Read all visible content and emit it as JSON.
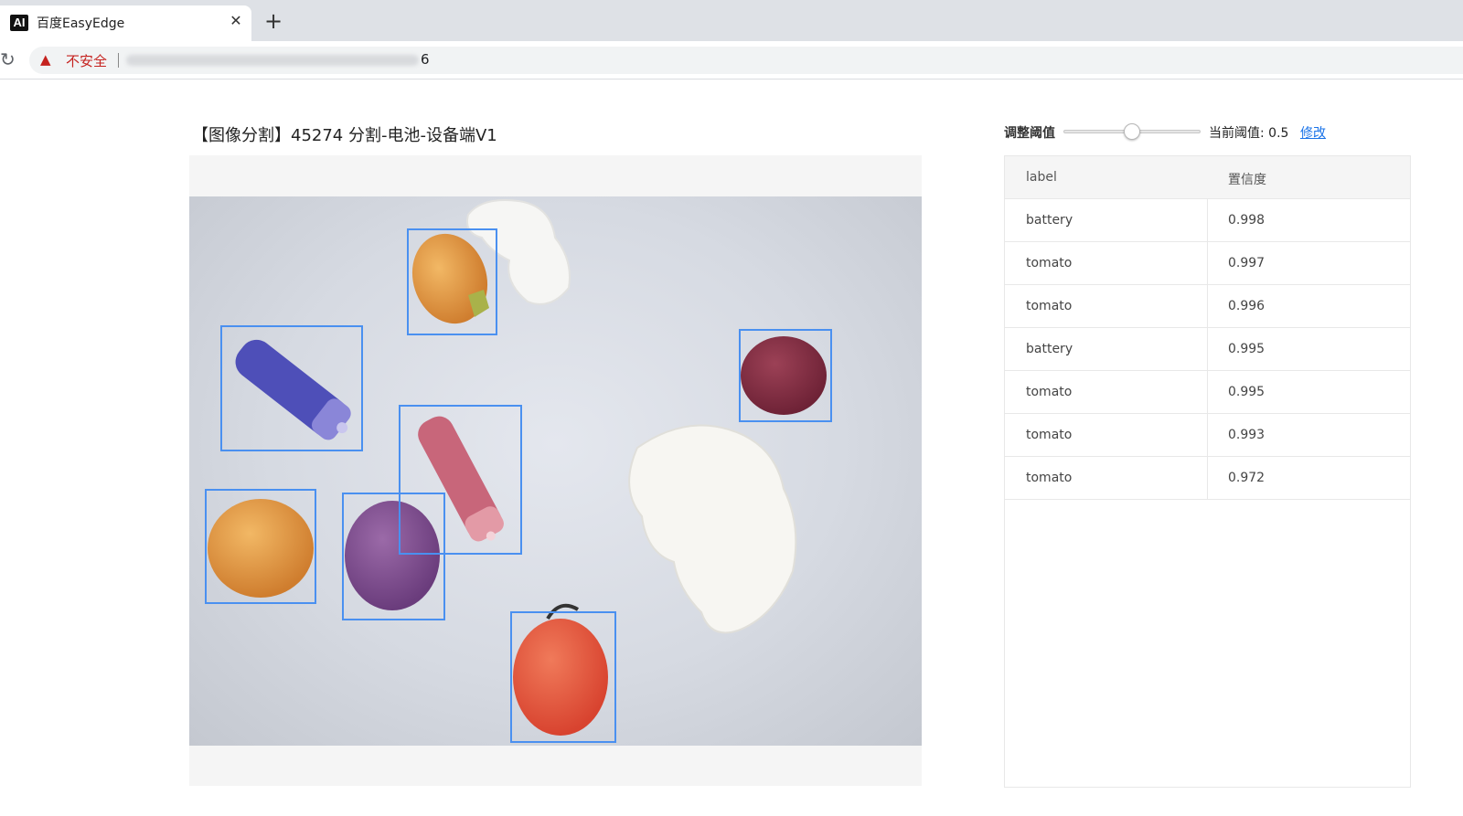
{
  "browser": {
    "tab_title": "百度EasyEdge",
    "favicon_text": "AI",
    "close_glyph": "✕",
    "new_tab_glyph": "+",
    "reload_glyph": "↻",
    "warning_glyph": "▲",
    "security_text": "不安全",
    "url_tail": "6"
  },
  "page": {
    "title": "【图像分割】45274  分割-电池-设备端V1"
  },
  "threshold": {
    "label": "调整阈值",
    "value": 0.5,
    "current_text": "当前阈值: 0.5",
    "edit_label": "修改"
  },
  "table": {
    "headers": [
      "label",
      "置信度"
    ],
    "rows": [
      {
        "label": "battery",
        "confidence": "0.998"
      },
      {
        "label": "tomato",
        "confidence": "0.997"
      },
      {
        "label": "tomato",
        "confidence": "0.996"
      },
      {
        "label": "battery",
        "confidence": "0.995"
      },
      {
        "label": "tomato",
        "confidence": "0.995"
      },
      {
        "label": "tomato",
        "confidence": "0.993"
      },
      {
        "label": "tomato",
        "confidence": "0.972"
      }
    ]
  },
  "colors": {
    "box": "#4a90f0",
    "link": "#1a73e8",
    "warning": "#c5221f"
  },
  "icons": [
    "reload-icon",
    "warning-icon",
    "close-icon",
    "plus-icon"
  ]
}
